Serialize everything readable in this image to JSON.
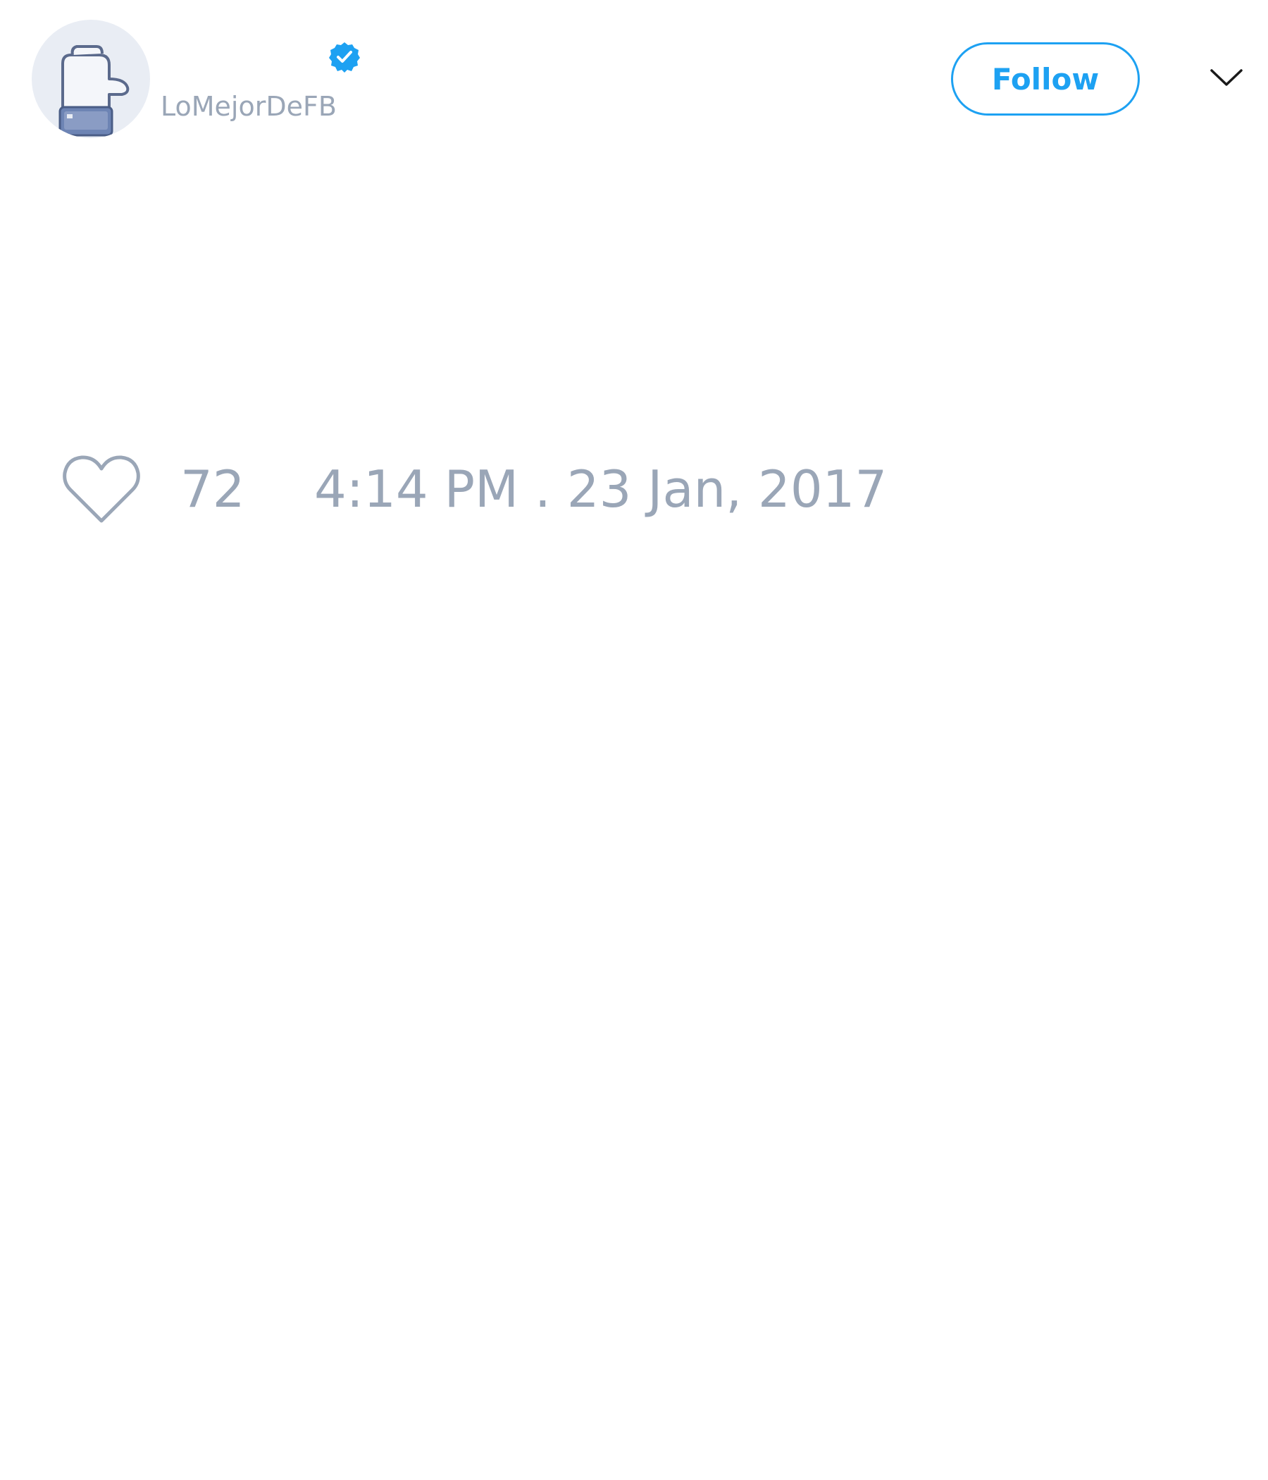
{
  "tweet": {
    "author": {
      "handle": "LoMejorDeFB",
      "verified": true,
      "avatar_icon": "thumbs-up-like-icon"
    },
    "follow_label": "Follow",
    "menu_icon": "chevron-down-icon",
    "likes": {
      "icon": "heart-icon",
      "count": "72"
    },
    "timestamp": "4:14 PM . 23 Jan, 2017"
  },
  "colors": {
    "accent": "#1da1f2",
    "muted_text": "#9aa6b7",
    "avatar_bg": "#e9edf4",
    "like_icon_blue": "#6d84b4"
  }
}
